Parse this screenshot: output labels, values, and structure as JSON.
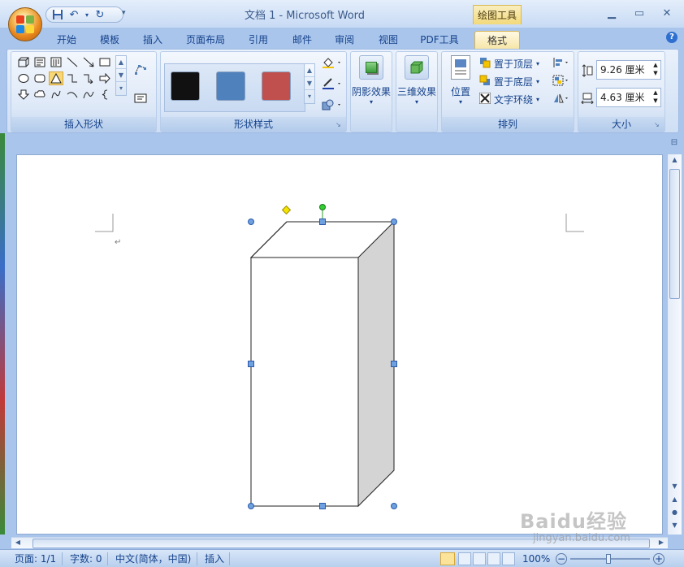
{
  "window": {
    "title": "文档 1 - Microsoft Word",
    "context_tab": "绘图工具"
  },
  "tabs": [
    "开始",
    "模板",
    "插入",
    "页面布局",
    "引用",
    "邮件",
    "审阅",
    "视图",
    "PDF工具",
    "格式"
  ],
  "active_tab": "格式",
  "ribbon": {
    "insert_shapes": {
      "label": "插入形状"
    },
    "shape_styles": {
      "label": "形状样式",
      "swatches": [
        "#111111",
        "#4f81bd",
        "#c0504d"
      ]
    },
    "shadow_effects": {
      "label": "阴影效果"
    },
    "3d_effects": {
      "label": "三维效果"
    },
    "arrange": {
      "label": "排列",
      "position": "位置",
      "bring_to_front": "置于顶层",
      "send_to_back": "置于底层",
      "text_wrapping": "文字环绕"
    },
    "size": {
      "label": "大小",
      "height": "9.26 厘米",
      "width": "4.63 厘米"
    }
  },
  "status": {
    "page": "页面: 1/1",
    "words": "字数: 0",
    "language": "中文(简体，中国)",
    "mode": "插入",
    "zoom": "100%"
  },
  "watermark": {
    "text": "Baidu经验",
    "sub": "jingyan.baidu.com"
  },
  "colors": {
    "ribbon_bg": "#dbe7f6",
    "accent": "#15428b",
    "context_tab": "#f2d97a",
    "selection": "#4f81bd"
  }
}
